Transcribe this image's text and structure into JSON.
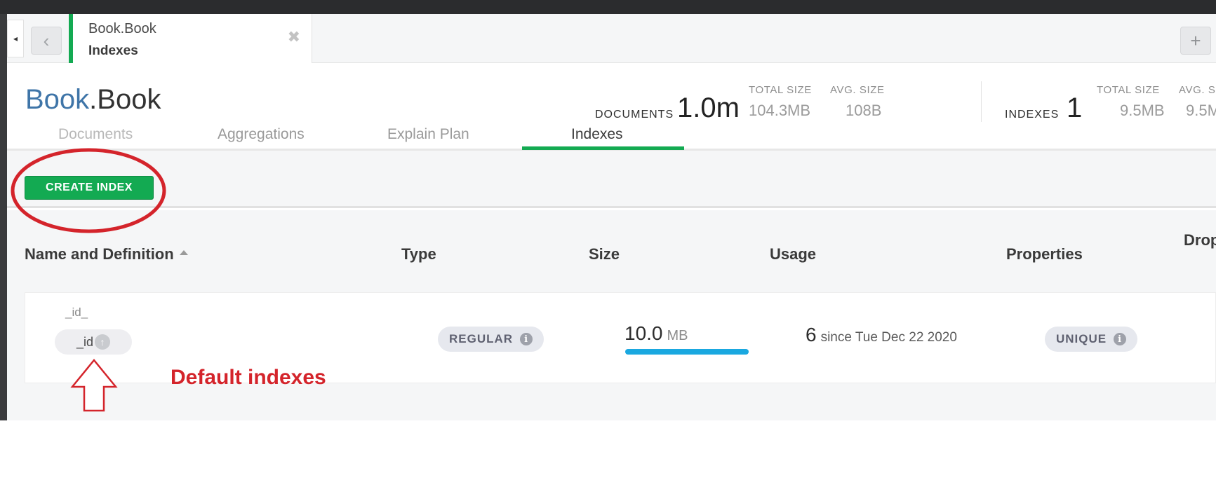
{
  "tab": {
    "title": "Book.Book",
    "subtitle": "Indexes"
  },
  "tabbar": {
    "scroll_left_glyph": "◂",
    "back_glyph": "‹",
    "close_glyph": "✖",
    "new_tab_glyph": "+"
  },
  "header": {
    "db": "Book",
    "sep": ".",
    "collection": "Book",
    "documents_label": "DOCUMENTS",
    "documents_value": "1.0m",
    "doc_total_size_label": "TOTAL SIZE",
    "doc_total_size_value": "104.3MB",
    "doc_avg_size_label": "AVG. SIZE",
    "doc_avg_size_value": "108B",
    "indexes_label": "INDEXES",
    "indexes_value": "1",
    "idx_total_size_label": "TOTAL SIZE",
    "idx_total_size_value": "9.5MB",
    "idx_avg_size_label": "AVG. S",
    "idx_avg_size_value": "9.5M"
  },
  "subtabs": [
    {
      "label": "Documents"
    },
    {
      "label": "Aggregations"
    },
    {
      "label": "Explain Plan"
    },
    {
      "label": "Indexes",
      "active": true
    }
  ],
  "toolbar": {
    "create_label": "CREATE INDEX"
  },
  "table": {
    "headers": [
      "Name and Definition",
      "Type",
      "Size",
      "Usage",
      "Properties",
      "Drop"
    ],
    "rows": [
      {
        "name": "_id_",
        "field": "_id",
        "direction_glyph": "↑",
        "type": "REGULAR",
        "size_value": "10.0",
        "size_unit": "MB",
        "usage_count": "6",
        "usage_since": "since Tue Dec 22 2020",
        "property": "UNIQUE"
      }
    ]
  },
  "annotation": {
    "text": "Default indexes",
    "color": "#d4242b"
  },
  "colors": {
    "accent": "#13aa52",
    "db_title": "#3f75a8",
    "size_bar": "#1aa8e0"
  },
  "icons": {
    "info": "i"
  }
}
